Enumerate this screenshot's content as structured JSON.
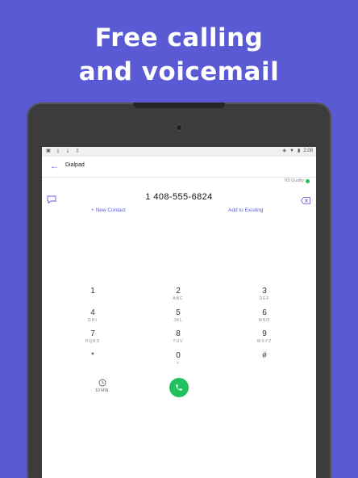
{
  "promo": {
    "headline_line1": "Free calling",
    "headline_line2": "and voicemail"
  },
  "statusbar": {
    "time": "2:08"
  },
  "appbar": {
    "title": "Dialpad"
  },
  "call_quality": {
    "label": "HD Quality"
  },
  "dialer": {
    "number": "1 408-555-6824",
    "new_contact_label": "+ New Contact",
    "add_existing_label": "Add to Existing"
  },
  "keypad": [
    {
      "digit": "1",
      "letters": ""
    },
    {
      "digit": "2",
      "letters": "ABC"
    },
    {
      "digit": "3",
      "letters": "DEF"
    },
    {
      "digit": "4",
      "letters": "GHI"
    },
    {
      "digit": "5",
      "letters": "JKL"
    },
    {
      "digit": "6",
      "letters": "MNO"
    },
    {
      "digit": "7",
      "letters": "PQRS"
    },
    {
      "digit": "8",
      "letters": "TUV"
    },
    {
      "digit": "9",
      "letters": "WXYZ"
    },
    {
      "digit": "*",
      "letters": ""
    },
    {
      "digit": "0",
      "letters": "+"
    },
    {
      "digit": "#",
      "letters": ""
    }
  ],
  "bottom": {
    "minutes_label": "10 MIN."
  },
  "colors": {
    "background": "#5a5bd4",
    "accent": "#5a5bd4",
    "call_button": "#1fc25c",
    "hd_indicator": "#20c060"
  }
}
